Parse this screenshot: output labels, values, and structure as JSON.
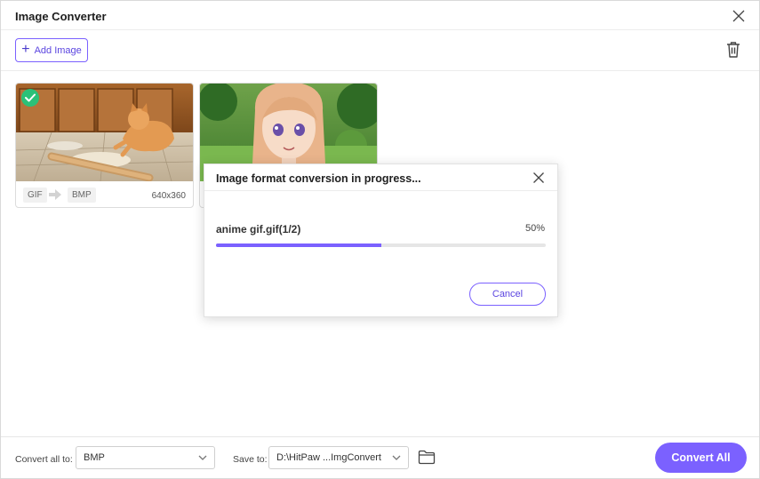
{
  "window": {
    "title": "Image Converter"
  },
  "toolbar": {
    "add_label": "Add Image"
  },
  "images": [
    {
      "from": "GIF",
      "to": "BMP",
      "resolution": "640x360",
      "done": true
    }
  ],
  "dialog": {
    "title": "Image format conversion in progress...",
    "file": "anime gif.gif(1/2)",
    "percent_label": "50%",
    "progress": 0.5,
    "cancel_label": "Cancel"
  },
  "footer": {
    "convert_all_label": "Convert all to:",
    "format_value": "BMP",
    "save_label": "Save to:",
    "save_path": "D:\\HitPaw ...ImgConvert",
    "convert_button": "Convert All"
  },
  "colors": {
    "accent": "#7b61ff",
    "success": "#2bc178"
  }
}
